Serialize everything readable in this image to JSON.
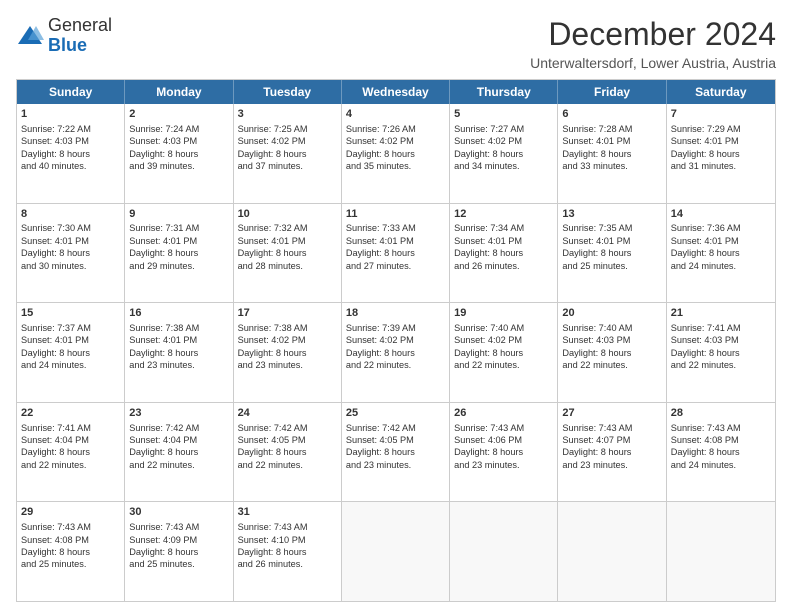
{
  "logo": {
    "general": "General",
    "blue": "Blue"
  },
  "title": "December 2024",
  "subtitle": "Unterwaltersdorf, Lower Austria, Austria",
  "header_days": [
    "Sunday",
    "Monday",
    "Tuesday",
    "Wednesday",
    "Thursday",
    "Friday",
    "Saturday"
  ],
  "weeks": [
    [
      {
        "day": "1",
        "lines": [
          "Sunrise: 7:22 AM",
          "Sunset: 4:03 PM",
          "Daylight: 8 hours",
          "and 40 minutes."
        ]
      },
      {
        "day": "2",
        "lines": [
          "Sunrise: 7:24 AM",
          "Sunset: 4:03 PM",
          "Daylight: 8 hours",
          "and 39 minutes."
        ]
      },
      {
        "day": "3",
        "lines": [
          "Sunrise: 7:25 AM",
          "Sunset: 4:02 PM",
          "Daylight: 8 hours",
          "and 37 minutes."
        ]
      },
      {
        "day": "4",
        "lines": [
          "Sunrise: 7:26 AM",
          "Sunset: 4:02 PM",
          "Daylight: 8 hours",
          "and 35 minutes."
        ]
      },
      {
        "day": "5",
        "lines": [
          "Sunrise: 7:27 AM",
          "Sunset: 4:02 PM",
          "Daylight: 8 hours",
          "and 34 minutes."
        ]
      },
      {
        "day": "6",
        "lines": [
          "Sunrise: 7:28 AM",
          "Sunset: 4:01 PM",
          "Daylight: 8 hours",
          "and 33 minutes."
        ]
      },
      {
        "day": "7",
        "lines": [
          "Sunrise: 7:29 AM",
          "Sunset: 4:01 PM",
          "Daylight: 8 hours",
          "and 31 minutes."
        ]
      }
    ],
    [
      {
        "day": "8",
        "lines": [
          "Sunrise: 7:30 AM",
          "Sunset: 4:01 PM",
          "Daylight: 8 hours",
          "and 30 minutes."
        ]
      },
      {
        "day": "9",
        "lines": [
          "Sunrise: 7:31 AM",
          "Sunset: 4:01 PM",
          "Daylight: 8 hours",
          "and 29 minutes."
        ]
      },
      {
        "day": "10",
        "lines": [
          "Sunrise: 7:32 AM",
          "Sunset: 4:01 PM",
          "Daylight: 8 hours",
          "and 28 minutes."
        ]
      },
      {
        "day": "11",
        "lines": [
          "Sunrise: 7:33 AM",
          "Sunset: 4:01 PM",
          "Daylight: 8 hours",
          "and 27 minutes."
        ]
      },
      {
        "day": "12",
        "lines": [
          "Sunrise: 7:34 AM",
          "Sunset: 4:01 PM",
          "Daylight: 8 hours",
          "and 26 minutes."
        ]
      },
      {
        "day": "13",
        "lines": [
          "Sunrise: 7:35 AM",
          "Sunset: 4:01 PM",
          "Daylight: 8 hours",
          "and 25 minutes."
        ]
      },
      {
        "day": "14",
        "lines": [
          "Sunrise: 7:36 AM",
          "Sunset: 4:01 PM",
          "Daylight: 8 hours",
          "and 24 minutes."
        ]
      }
    ],
    [
      {
        "day": "15",
        "lines": [
          "Sunrise: 7:37 AM",
          "Sunset: 4:01 PM",
          "Daylight: 8 hours",
          "and 24 minutes."
        ]
      },
      {
        "day": "16",
        "lines": [
          "Sunrise: 7:38 AM",
          "Sunset: 4:01 PM",
          "Daylight: 8 hours",
          "and 23 minutes."
        ]
      },
      {
        "day": "17",
        "lines": [
          "Sunrise: 7:38 AM",
          "Sunset: 4:02 PM",
          "Daylight: 8 hours",
          "and 23 minutes."
        ]
      },
      {
        "day": "18",
        "lines": [
          "Sunrise: 7:39 AM",
          "Sunset: 4:02 PM",
          "Daylight: 8 hours",
          "and 22 minutes."
        ]
      },
      {
        "day": "19",
        "lines": [
          "Sunrise: 7:40 AM",
          "Sunset: 4:02 PM",
          "Daylight: 8 hours",
          "and 22 minutes."
        ]
      },
      {
        "day": "20",
        "lines": [
          "Sunrise: 7:40 AM",
          "Sunset: 4:03 PM",
          "Daylight: 8 hours",
          "and 22 minutes."
        ]
      },
      {
        "day": "21",
        "lines": [
          "Sunrise: 7:41 AM",
          "Sunset: 4:03 PM",
          "Daylight: 8 hours",
          "and 22 minutes."
        ]
      }
    ],
    [
      {
        "day": "22",
        "lines": [
          "Sunrise: 7:41 AM",
          "Sunset: 4:04 PM",
          "Daylight: 8 hours",
          "and 22 minutes."
        ]
      },
      {
        "day": "23",
        "lines": [
          "Sunrise: 7:42 AM",
          "Sunset: 4:04 PM",
          "Daylight: 8 hours",
          "and 22 minutes."
        ]
      },
      {
        "day": "24",
        "lines": [
          "Sunrise: 7:42 AM",
          "Sunset: 4:05 PM",
          "Daylight: 8 hours",
          "and 22 minutes."
        ]
      },
      {
        "day": "25",
        "lines": [
          "Sunrise: 7:42 AM",
          "Sunset: 4:05 PM",
          "Daylight: 8 hours",
          "and 23 minutes."
        ]
      },
      {
        "day": "26",
        "lines": [
          "Sunrise: 7:43 AM",
          "Sunset: 4:06 PM",
          "Daylight: 8 hours",
          "and 23 minutes."
        ]
      },
      {
        "day": "27",
        "lines": [
          "Sunrise: 7:43 AM",
          "Sunset: 4:07 PM",
          "Daylight: 8 hours",
          "and 23 minutes."
        ]
      },
      {
        "day": "28",
        "lines": [
          "Sunrise: 7:43 AM",
          "Sunset: 4:08 PM",
          "Daylight: 8 hours",
          "and 24 minutes."
        ]
      }
    ],
    [
      {
        "day": "29",
        "lines": [
          "Sunrise: 7:43 AM",
          "Sunset: 4:08 PM",
          "Daylight: 8 hours",
          "and 25 minutes."
        ]
      },
      {
        "day": "30",
        "lines": [
          "Sunrise: 7:43 AM",
          "Sunset: 4:09 PM",
          "Daylight: 8 hours",
          "and 25 minutes."
        ]
      },
      {
        "day": "31",
        "lines": [
          "Sunrise: 7:43 AM",
          "Sunset: 4:10 PM",
          "Daylight: 8 hours",
          "and 26 minutes."
        ]
      },
      null,
      null,
      null,
      null
    ]
  ]
}
